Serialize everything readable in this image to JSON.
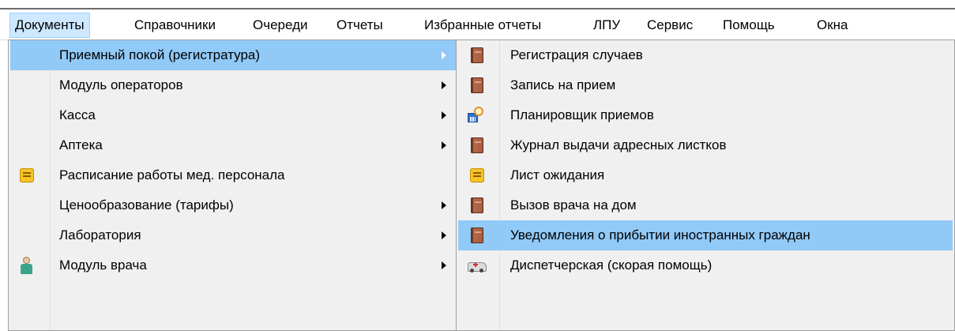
{
  "menubar": {
    "items": [
      "Документы",
      "Справочники",
      "Очереди",
      "Отчеты",
      "Избранные отчеты",
      "ЛПУ",
      "Сервис",
      "Помощь",
      "Окна"
    ],
    "active_index": 0
  },
  "documents_menu": {
    "items": [
      {
        "label": "Приемный покой (регистратура)",
        "submenu": true,
        "icon": ""
      },
      {
        "label": "Модуль операторов",
        "submenu": true,
        "icon": ""
      },
      {
        "label": "Касса",
        "submenu": true,
        "icon": ""
      },
      {
        "label": "Аптека",
        "submenu": true,
        "icon": ""
      },
      {
        "label": "Расписание работы мед. персонала",
        "submenu": false,
        "icon": "note-icon"
      },
      {
        "label": "Ценообразование (тарифы)",
        "submenu": true,
        "icon": ""
      },
      {
        "label": "Лаборатория",
        "submenu": true,
        "icon": ""
      },
      {
        "label": "Модуль врача",
        "submenu": true,
        "icon": "doctor-icon"
      }
    ],
    "active_index": 0
  },
  "reception_submenu": {
    "items": [
      {
        "label": "Регистрация случаев",
        "icon": "book-icon"
      },
      {
        "label": "Запись на прием",
        "icon": "book-icon"
      },
      {
        "label": "Планировщик приемов",
        "icon": "schedule-icon"
      },
      {
        "label": "Журнал выдачи адресных листков",
        "icon": "book-icon"
      },
      {
        "label": "Лист ожидания",
        "icon": "note-icon"
      },
      {
        "label": "Вызов врача на дом",
        "icon": "book-icon"
      },
      {
        "label": "Уведомления о прибытии иностранных граждан",
        "icon": "book-icon"
      },
      {
        "label": "Диспетчерская (скорая помощь)",
        "icon": "ambulance-icon"
      }
    ],
    "hover_index": 6
  },
  "colors": {
    "highlight": "#91c9f7",
    "menubar_active": "#cde8ff",
    "menu_bg": "#f0f0f0"
  }
}
